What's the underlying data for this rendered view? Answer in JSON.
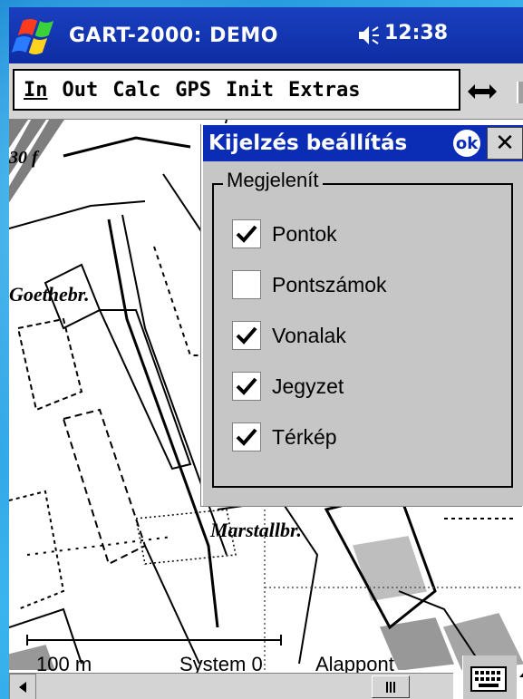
{
  "titlebar": {
    "title": "GART-2000: DEMO",
    "time": "12:38",
    "color": "#0d2da3"
  },
  "menubar": {
    "items": [
      {
        "label": "In"
      },
      {
        "label": "Out"
      },
      {
        "label": "Calc"
      },
      {
        "label": "GPS"
      },
      {
        "label": "Init"
      },
      {
        "label": "Extras"
      }
    ],
    "arrow_icon": "left-right-arrow-icon"
  },
  "map": {
    "labels": {
      "parcel": "30 f",
      "street1": "Goethebr.",
      "street2": "Marstallbr."
    }
  },
  "dialog": {
    "title": "Kijelzés beállítás",
    "ok_label": "ok",
    "close_label": "✕",
    "group_label": "Megjelenít",
    "options": [
      {
        "label": "Pontok",
        "checked": true
      },
      {
        "label": "Pontszámok",
        "checked": false
      },
      {
        "label": "Vonalak",
        "checked": true
      },
      {
        "label": "Jegyzet",
        "checked": true
      },
      {
        "label": "Térkép",
        "checked": true
      }
    ],
    "title_color": "#0b2db6"
  },
  "status": {
    "scale": "100 m",
    "system": "System 0",
    "alap": "Alappont"
  }
}
